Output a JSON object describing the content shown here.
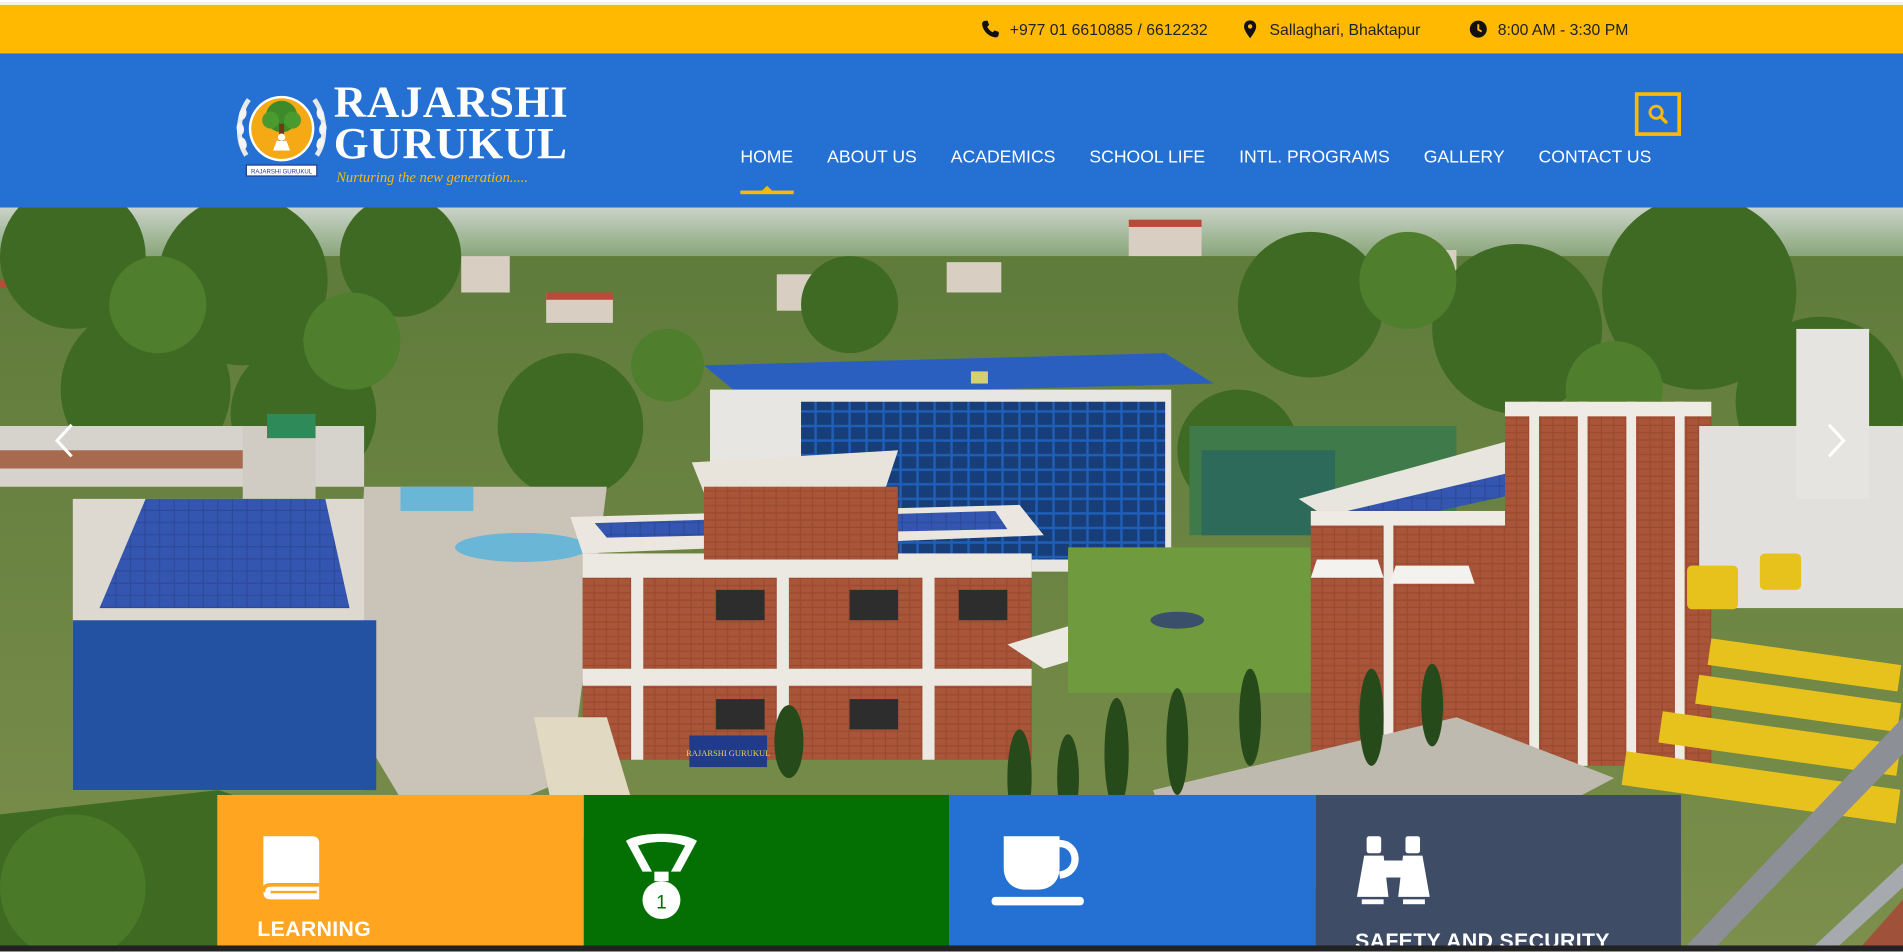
{
  "topbar": {
    "phone": "+977 01 6610885 / 6612232",
    "address": "Sallaghari, Bhaktapur",
    "hours": "8:00 AM - 3:30 PM",
    "background": "#ffb900"
  },
  "logo": {
    "line1": "RAJARSHI",
    "line2": "GURUKUL",
    "tagline": "Nurturing the new generation.....",
    "emblem_text": "RAJARSHI GURUKUL"
  },
  "header": {
    "background": "#2570d3",
    "search_icon": "search-icon"
  },
  "nav": {
    "items": [
      {
        "label": "HOME",
        "active": true
      },
      {
        "label": "ABOUT US",
        "active": false
      },
      {
        "label": "ACADEMICS",
        "active": false
      },
      {
        "label": "SCHOOL LIFE",
        "active": false
      },
      {
        "label": "INTL. PROGRAMS",
        "active": false
      },
      {
        "label": "GALLERY",
        "active": false
      },
      {
        "label": "CONTACT US",
        "active": false
      }
    ]
  },
  "hero": {
    "prev_icon": "chevron-left-icon",
    "next_icon": "chevron-right-icon",
    "sign_text": "RAJARSHI GURUKUL"
  },
  "features": [
    {
      "label": "LEARNING",
      "icon": "book-icon",
      "color": "#ffa51f"
    },
    {
      "label": "",
      "icon": "medal-icon",
      "medal_number": "1",
      "color": "#047003"
    },
    {
      "label": "",
      "icon": "coffee-cup-icon",
      "color": "#2570d3"
    },
    {
      "label": "SAFETY AND SECURITY",
      "icon": "binoculars-icon",
      "color": "#3e4c66"
    }
  ]
}
